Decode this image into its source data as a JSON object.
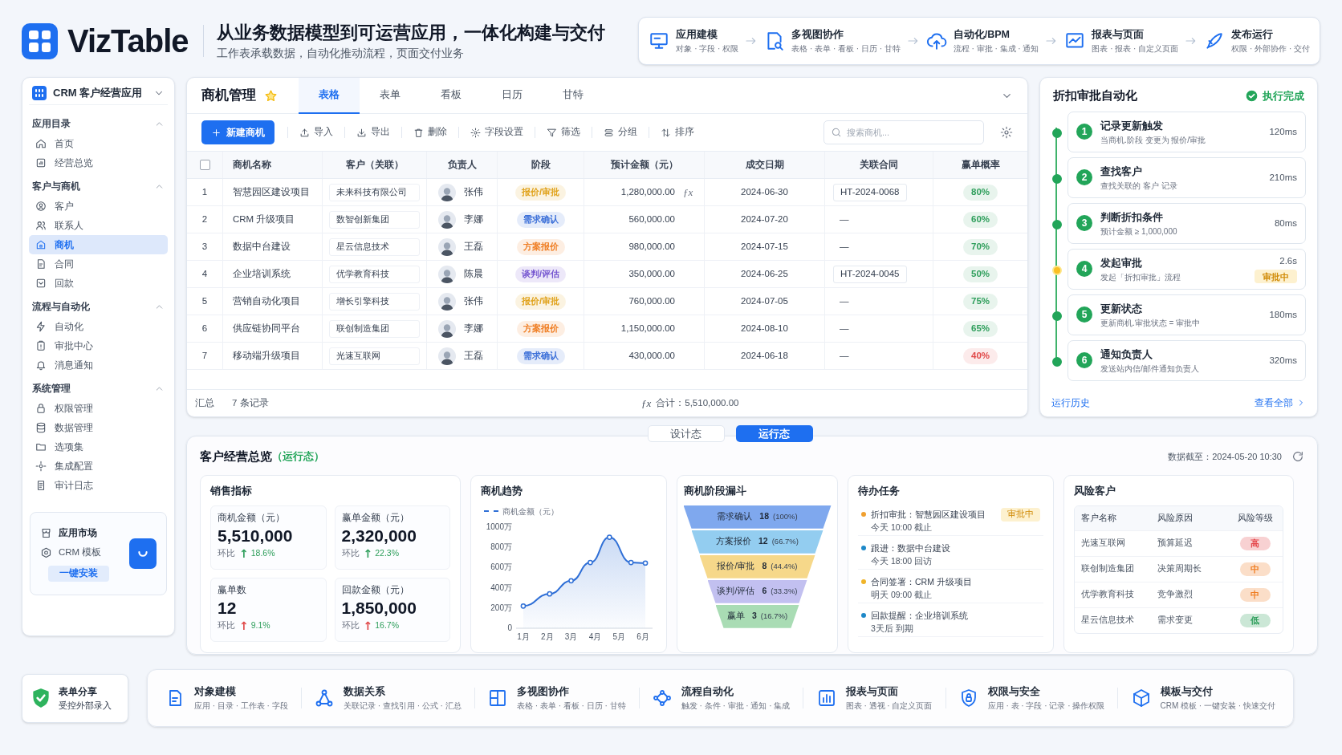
{
  "brand": {
    "name": "VizTable",
    "headline": "从业务数据模型到可运营应用，一体化构建与交付",
    "subline": "工作表承载数据，自动化推动流程，页面交付业务"
  },
  "pipeline": [
    {
      "title": "应用建模",
      "sub": "对象 · 字段 · 权限"
    },
    {
      "title": "多视图协作",
      "sub": "表格 · 表单 · 看板 · 日历 · 甘特"
    },
    {
      "title": "自动化/BPM",
      "sub": "流程 · 审批 · 集成 · 通知"
    },
    {
      "title": "报表与页面",
      "sub": "图表 · 报表 · 自定义页面"
    },
    {
      "title": "发布运行",
      "sub": "权限 · 外部协作 · 交付"
    }
  ],
  "sidebar": {
    "app": "CRM 客户经营应用",
    "groups": [
      {
        "title": "应用目录",
        "expanded": true,
        "items": [
          {
            "label": "首页",
            "selected": false
          },
          {
            "label": "经营总览",
            "selected": false
          }
        ]
      },
      {
        "title": "客户与商机",
        "expanded": true,
        "items": [
          {
            "label": "客户",
            "selected": false
          },
          {
            "label": "联系人",
            "selected": false
          },
          {
            "label": "商机",
            "selected": true
          },
          {
            "label": "合同",
            "selected": false
          },
          {
            "label": "回款",
            "selected": false
          }
        ]
      },
      {
        "title": "流程与自动化",
        "expanded": true,
        "items": [
          {
            "label": "自动化",
            "selected": false
          },
          {
            "label": "审批中心",
            "selected": false
          },
          {
            "label": "消息通知",
            "selected": false
          }
        ]
      },
      {
        "title": "系统管理",
        "expanded": true,
        "items": [
          {
            "label": "权限管理",
            "selected": false
          },
          {
            "label": "数据管理",
            "selected": false
          },
          {
            "label": "选项集",
            "selected": false
          },
          {
            "label": "集成配置",
            "selected": false
          },
          {
            "label": "审计日志",
            "selected": false
          }
        ]
      }
    ]
  },
  "market": {
    "title": "应用市场",
    "template": "CRM 模板",
    "button": "一键安装"
  },
  "share": {
    "title": "表单分享",
    "sub": "受控外部录入"
  },
  "table_view": {
    "title": "商机管理",
    "starred": true,
    "tabs": [
      {
        "label": "表格",
        "selected": true
      },
      {
        "label": "表单",
        "selected": false
      },
      {
        "label": "看板",
        "selected": false
      },
      {
        "label": "日历",
        "selected": false
      },
      {
        "label": "甘特",
        "selected": false
      }
    ],
    "new_button": "新建商机",
    "tools": [
      "导入",
      "导出",
      "删除",
      "字段设置",
      "筛选",
      "分组",
      "排序"
    ],
    "search": {
      "placeholder": "搜索商机..."
    },
    "select_all": {
      "checked": false
    },
    "columns": [
      "商机名称",
      "客户（关联）",
      "负责人",
      "阶段",
      "预计金额（元）",
      "成交日期",
      "关联合同",
      "赢单概率"
    ],
    "rows": [
      {
        "no": "1",
        "name": "智慧园区建设项目",
        "customer": "未来科技有限公司",
        "owner": "张伟",
        "stage": {
          "label": "报价/审批",
          "color": "#e0a21b"
        },
        "amount": "1,280,000.00",
        "formula": "ƒx",
        "date": "2024-06-30",
        "contract": "HT-2024-0068",
        "rate": {
          "label": "80%",
          "color": "#2e9e5b"
        }
      },
      {
        "no": "2",
        "name": "CRM 升级项目",
        "customer": "数智创新集团",
        "owner": "李娜",
        "stage": {
          "label": "需求确认",
          "color": "#3b6fd8"
        },
        "amount": "560,000.00",
        "date": "2024-07-20",
        "contract": "—",
        "rate": {
          "label": "60%",
          "color": "#2e9e5b"
        }
      },
      {
        "no": "3",
        "name": "数据中台建设",
        "customer": "星云信息技术",
        "owner": "王磊",
        "stage": {
          "label": "方案报价",
          "color": "#ef7d22"
        },
        "amount": "980,000.00",
        "date": "2024-07-15",
        "contract": "—",
        "rate": {
          "label": "70%",
          "color": "#2e9e5b"
        }
      },
      {
        "no": "4",
        "name": "企业培训系统",
        "customer": "优学教育科技",
        "owner": "陈晨",
        "stage": {
          "label": "谈判/评估",
          "color": "#7556d0"
        },
        "amount": "350,000.00",
        "date": "2024-06-25",
        "contract": "HT-2024-0045",
        "rate": {
          "label": "50%",
          "color": "#2e9e5b"
        }
      },
      {
        "no": "5",
        "name": "营销自动化项目",
        "customer": "增长引擎科技",
        "owner": "张伟",
        "stage": {
          "label": "报价/审批",
          "color": "#e0a21b"
        },
        "amount": "760,000.00",
        "date": "2024-07-05",
        "contract": "—",
        "rate": {
          "label": "75%",
          "color": "#2e9e5b"
        }
      },
      {
        "no": "6",
        "name": "供应链协同平台",
        "customer": "联创制造集团",
        "owner": "李娜",
        "stage": {
          "label": "方案报价",
          "color": "#ef7d22"
        },
        "amount": "1,150,000.00",
        "date": "2024-08-10",
        "contract": "—",
        "rate": {
          "label": "65%",
          "color": "#2e9e5b"
        }
      },
      {
        "no": "7",
        "name": "移动端升级项目",
        "customer": "光速互联网",
        "owner": "王磊",
        "stage": {
          "label": "需求确认",
          "color": "#3b6fd8"
        },
        "amount": "430,000.00",
        "date": "2024-06-18",
        "contract": "—",
        "rate": {
          "label": "40%",
          "color": "#e04848"
        }
      }
    ],
    "footer": {
      "label": "汇总",
      "count": "7 条记录",
      "formula": "ƒx",
      "sum": "合计：5,510,000.00"
    }
  },
  "automation": {
    "title": "折扣审批自动化",
    "status": "执行完成",
    "steps": [
      {
        "no": "1",
        "title": "记录更新触发",
        "desc": "当商机.阶段 变更为 报价/审批",
        "time": "120ms",
        "waiting": false
      },
      {
        "no": "2",
        "title": "查找客户",
        "desc": "查找关联的 客户 记录",
        "time": "210ms",
        "waiting": false
      },
      {
        "no": "3",
        "title": "判断折扣条件",
        "desc": "预计金额 ≥ 1,000,000",
        "time": "80ms",
        "waiting": false
      },
      {
        "no": "4",
        "title": "发起审批",
        "desc": "发起「折扣审批」流程",
        "time": "2.6s",
        "waiting": true,
        "badge": "审批中"
      },
      {
        "no": "5",
        "title": "更新状态",
        "desc": "更新商机.审批状态 = 审批中",
        "time": "180ms",
        "waiting": false
      },
      {
        "no": "6",
        "title": "通知负责人",
        "desc": "发送站内信/邮件通知负责人",
        "time": "320ms",
        "waiting": false
      }
    ],
    "history": "运行历史",
    "view_all": "查看全部"
  },
  "modes": [
    {
      "label": "设计态",
      "selected": false
    },
    {
      "label": "运行态",
      "selected": true
    }
  ],
  "overview": {
    "title": "客户经营总览",
    "mode": "（运行态）",
    "updated": "数据截至：2024-05-20 10:30",
    "metrics": {
      "title": "销售指标",
      "items": [
        {
          "label": "商机金额（元）",
          "value": "5,510,000",
          "change_label": "环比",
          "arrow": "↑",
          "color": "#2e9e5b",
          "change": "18.6%"
        },
        {
          "label": "赢单金额（元）",
          "value": "2,320,000",
          "change_label": "环比",
          "arrow": "↑",
          "color": "#2e9e5b",
          "change": "22.3%"
        },
        {
          "label": "赢单数",
          "value": "12",
          "change_label": "环比",
          "arrow": "↑",
          "color": "#e04848",
          "change": "9.1%"
        },
        {
          "label": "回款金额（元）",
          "value": "1,850,000",
          "change_label": "环比",
          "arrow": "↑",
          "color": "#e04848",
          "change": "16.7%"
        }
      ]
    },
    "trend": {
      "title": "商机趋势",
      "chart_data": {
        "type": "area",
        "x": [
          1,
          2.1,
          3,
          3.8,
          4.6,
          5.5,
          6.1
        ],
        "series": [
          {
            "name": "商机金额（元）",
            "color": "#2f6fd6",
            "values": [
              220,
              340,
              470,
              650,
              900,
              650,
              645
            ]
          }
        ],
        "xlim": [
          0.7,
          6.4
        ],
        "ylim": [
          0,
          1000
        ],
        "xticks": [
          {
            "value": 1,
            "label": "1月"
          },
          {
            "value": 2,
            "label": "2月"
          },
          {
            "value": 3,
            "label": "3月"
          },
          {
            "value": 4,
            "label": "4月"
          },
          {
            "value": 5,
            "label": "5月"
          },
          {
            "value": 6,
            "label": "6月"
          }
        ],
        "yticks": [
          {
            "value": 0,
            "label": "0"
          },
          {
            "value": 200,
            "label": "200万"
          },
          {
            "value": 400,
            "label": "400万"
          },
          {
            "value": 600,
            "label": "600万"
          },
          {
            "value": 800,
            "label": "800万"
          },
          {
            "value": 1000,
            "label": "1000万"
          }
        ]
      }
    },
    "funnel": {
      "title": "商机阶段漏斗",
      "stages": [
        {
          "label": "需求确认",
          "count": "18",
          "percent": "(100%)",
          "color": "#7fa8ee"
        },
        {
          "label": "方案报价",
          "count": "12",
          "percent": "(66.7%)",
          "color": "#93cdf0"
        },
        {
          "label": "报价/审批",
          "count": "8",
          "percent": "(44.4%)",
          "color": "#f6d88a"
        },
        {
          "label": "谈判/评估",
          "count": "6",
          "percent": "(33.3%)",
          "color": "#c2c0f0"
        },
        {
          "label": "赢单",
          "count": "3",
          "percent": "(16.7%)",
          "color": "#a9dcb4"
        }
      ]
    },
    "tasks": {
      "title": "待办任务",
      "items": [
        {
          "title": "折扣审批：智慧园区建设项目",
          "due": "今天 10:00 截止",
          "color": "#f0a030",
          "badge": "审批中"
        },
        {
          "title": "跟进：数据中台建设",
          "due": "今天 18:00 回访",
          "color": "#1e88c8"
        },
        {
          "title": "合同签署：CRM 升级项目",
          "due": "明天 09:00 截止",
          "color": "#f0b429"
        },
        {
          "title": "回款提醒：企业培训系统",
          "due": "3天后 到期",
          "color": "#1e88c8"
        }
      ]
    },
    "risk": {
      "title": "风险客户",
      "columns": [
        "客户名称",
        "风险原因",
        "风险等级"
      ],
      "rows": [
        {
          "name": "光速互联网",
          "reason": "预算延迟",
          "level": "高",
          "color": "#e5484d"
        },
        {
          "name": "联创制造集团",
          "reason": "决策周期长",
          "level": "中",
          "color": "#ef7d22"
        },
        {
          "name": "优学教育科技",
          "reason": "竞争激烈",
          "level": "中",
          "color": "#ef7d22"
        },
        {
          "name": "星云信息技术",
          "reason": "需求变更",
          "level": "低",
          "color": "#2e9e5b"
        }
      ]
    }
  },
  "features": [
    {
      "title": "对象建模",
      "sub": "应用 · 目录 · 工作表 · 字段"
    },
    {
      "title": "数据关系",
      "sub": "关联记录 · 查找引用 · 公式 · 汇总"
    },
    {
      "title": "多视图协作",
      "sub": "表格 · 表单 · 看板 · 日历 · 甘特"
    },
    {
      "title": "流程自动化",
      "sub": "触发 · 条件 · 审批 · 通知 · 集成"
    },
    {
      "title": "报表与页面",
      "sub": "图表 · 透视 · 自定义页面"
    },
    {
      "title": "权限与安全",
      "sub": "应用 · 表 · 字段 · 记录 · 操作权限"
    },
    {
      "title": "模板与交付",
      "sub": "CRM 模板 · 一键安装 · 快速交付"
    }
  ]
}
